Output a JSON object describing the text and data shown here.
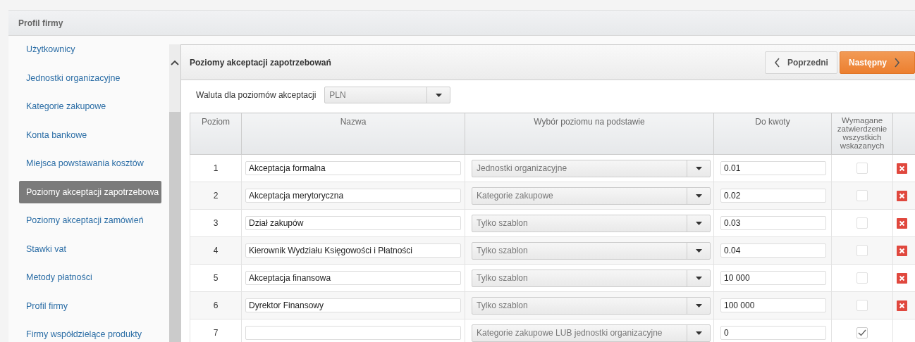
{
  "section_title": "Profil firmy",
  "sidebar": {
    "items": [
      {
        "label": "Użytkownicy",
        "selected": false
      },
      {
        "label": "Jednostki organizacyjne",
        "selected": false
      },
      {
        "label": "Kategorie zakupowe",
        "selected": false
      },
      {
        "label": "Konta bankowe",
        "selected": false
      },
      {
        "label": "Miejsca powstawania kosztów",
        "selected": false
      },
      {
        "label": "Poziomy akceptacji zapotrzebowa",
        "selected": true
      },
      {
        "label": "Poziomy akceptacji zamówień",
        "selected": false
      },
      {
        "label": "Stawki vat",
        "selected": false
      },
      {
        "label": "Metody płatności",
        "selected": false
      },
      {
        "label": "Profil firmy",
        "selected": false
      },
      {
        "label": "Firmy współdzielące produkty",
        "selected": false
      }
    ]
  },
  "panel": {
    "title": "Poziomy akceptacji zapotrzebowań",
    "buttons": [
      {
        "label": "Poprzedni",
        "kind": "prev"
      },
      {
        "label": "Następny",
        "kind": "next"
      }
    ]
  },
  "currency": {
    "label": "Waluta dla poziomów akceptacji",
    "value": "PLN"
  },
  "table": {
    "columns": [
      "Poziom",
      "Nazwa",
      "Wybór poziomu na podstawie",
      "Do kwoty",
      "Wymagane zatwierdzenie wszystkich wskazanych"
    ],
    "rows": [
      {
        "number": "1",
        "name": "Akceptacja formalna",
        "basis": "Jednostki organizacyjne",
        "amount": "0.01",
        "checked": false,
        "deletable": true
      },
      {
        "number": "2",
        "name": "Akceptacja merytoryczna",
        "basis": "Kategorie zakupowe",
        "amount": "0.02",
        "checked": false,
        "deletable": true
      },
      {
        "number": "3",
        "name": "Dział zakupów",
        "basis": "Tylko szablon",
        "amount": "0.03",
        "checked": false,
        "deletable": true
      },
      {
        "number": "4",
        "name": "Kierownik Wydziału Księgowości i Płatności",
        "basis": "Tylko szablon",
        "amount": "0.04",
        "checked": false,
        "deletable": true
      },
      {
        "number": "5",
        "name": "Akceptacja finansowa",
        "basis": "Tylko szablon",
        "amount": "10 000",
        "checked": false,
        "deletable": true
      },
      {
        "number": "6",
        "name": "Dyrektor Finansowy",
        "basis": "Tylko szablon",
        "amount": "100 000",
        "checked": false,
        "deletable": true
      },
      {
        "number": "7",
        "basis": "Kategorie zakupowe LUB jednostki organizacyjne",
        "amount": "0",
        "checked": true,
        "deletable": false
      }
    ]
  }
}
